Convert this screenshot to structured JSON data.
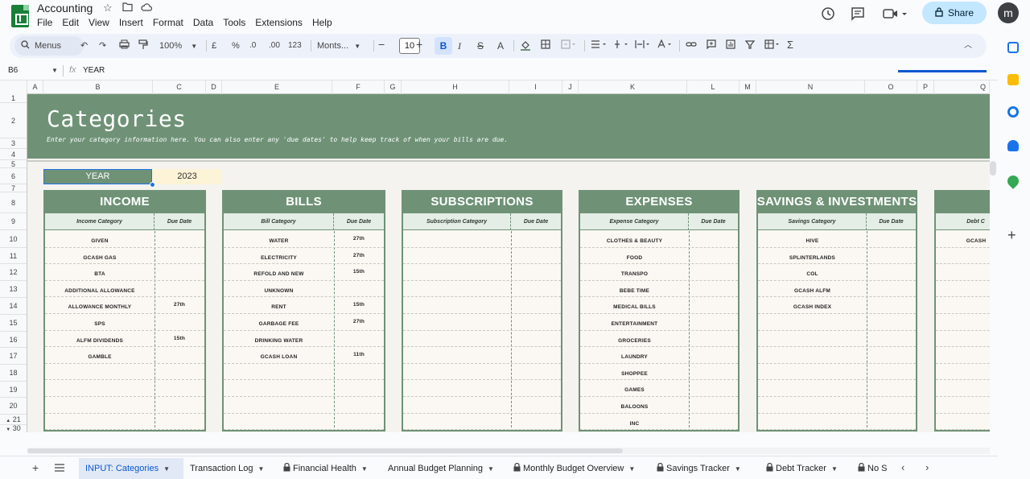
{
  "app": {
    "doc_title": "Accounting",
    "menu": [
      "File",
      "Edit",
      "View",
      "Insert",
      "Format",
      "Data",
      "Tools",
      "Extensions",
      "Help"
    ],
    "share_label": "Share",
    "avatar_letter": "m"
  },
  "toolbar": {
    "menus_label": "Menus",
    "zoom": "100%",
    "currency": "£",
    "percent": "%",
    "dec_decrease": ".0",
    "dec_increase": ".00",
    "number_format": "123",
    "font": "Monts...",
    "font_size": "10",
    "bold": "B",
    "italic": "I",
    "strike": "S",
    "text_color": "A",
    "sigma": "Σ"
  },
  "formula_bar": {
    "cell_ref": "B6",
    "content": "YEAR"
  },
  "columns": [
    "A",
    "B",
    "C",
    "D",
    "E",
    "F",
    "G",
    "H",
    "I",
    "J",
    "K",
    "L",
    "M",
    "N",
    "O",
    "P",
    "Q"
  ],
  "rows": [
    "1",
    "2",
    "3",
    "4",
    "5",
    "6",
    "7",
    "8",
    "9",
    "10",
    "11",
    "12",
    "13",
    "14",
    "15",
    "16",
    "17",
    "18",
    "19",
    "20",
    "21",
    "30"
  ],
  "sheet": {
    "title": "Categories",
    "subtitle": "Enter your category information here. You can also enter any 'due dates' to help keep track of when your bills are due.",
    "year_label": "YEAR",
    "year_value": "2023"
  },
  "cards": [
    {
      "title": "INCOME",
      "cat_header": "Income Category",
      "due_header": "Due Date",
      "items": [
        {
          "name": "GIVEN",
          "due": ""
        },
        {
          "name": "GCASH GAS",
          "due": ""
        },
        {
          "name": "BTA",
          "due": ""
        },
        {
          "name": "ADDITIONAL ALLOWANCE",
          "due": ""
        },
        {
          "name": "ALLOWANCE MONTHLY",
          "due": "27th"
        },
        {
          "name": "SPS",
          "due": ""
        },
        {
          "name": "ALFM DIVIDENDS",
          "due": "15th"
        },
        {
          "name": "GAMBLE",
          "due": ""
        }
      ]
    },
    {
      "title": "BILLS",
      "cat_header": "Bill Category",
      "due_header": "Due Date",
      "items": [
        {
          "name": "WATER",
          "due": "27th"
        },
        {
          "name": "ELECTRICITY",
          "due": "27th"
        },
        {
          "name": "REFOLD AND NEW",
          "due": "15th"
        },
        {
          "name": "UNKNOWN",
          "due": ""
        },
        {
          "name": "RENT",
          "due": "15th"
        },
        {
          "name": "GARBAGE FEE",
          "due": "27th"
        },
        {
          "name": "DRINKING WATER",
          "due": ""
        },
        {
          "name": "GCASH LOAN",
          "due": "11th"
        }
      ]
    },
    {
      "title": "SUBSCRIPTIONS",
      "cat_header": "Subscription Category",
      "due_header": "Due Date",
      "items": []
    },
    {
      "title": "EXPENSES",
      "cat_header": "Expense Category",
      "due_header": "Due Date",
      "items": [
        {
          "name": "CLOTHES & BEAUTY",
          "due": ""
        },
        {
          "name": "FOOD",
          "due": ""
        },
        {
          "name": "TRANSPO",
          "due": ""
        },
        {
          "name": "BEBE TIME",
          "due": ""
        },
        {
          "name": "MEDICAL BILLS",
          "due": ""
        },
        {
          "name": "ENTERTAINMENT",
          "due": ""
        },
        {
          "name": "GROCERIES",
          "due": ""
        },
        {
          "name": "LAUNDRY",
          "due": ""
        },
        {
          "name": "SHOPPEE",
          "due": ""
        },
        {
          "name": "GAMES",
          "due": ""
        },
        {
          "name": "BALOONS",
          "due": ""
        },
        {
          "name": "INC",
          "due": ""
        }
      ]
    },
    {
      "title": "SAVINGS & INVESTMENTS",
      "cat_header": "Savings Category",
      "due_header": "Due Date",
      "items": [
        {
          "name": "HIVE",
          "due": ""
        },
        {
          "name": "SPLINTERLANDS",
          "due": ""
        },
        {
          "name": "COL",
          "due": ""
        },
        {
          "name": "GCASH ALFM",
          "due": ""
        },
        {
          "name": "GCASH INDEX",
          "due": ""
        }
      ]
    },
    {
      "title": "",
      "cat_header": "Debt C",
      "due_header": "",
      "items": [
        {
          "name": "GCASH",
          "due": ""
        }
      ]
    }
  ],
  "tabs": [
    {
      "label": "INPUT: Categories",
      "locked": false,
      "active": true
    },
    {
      "label": "Transaction Log",
      "locked": false,
      "active": false
    },
    {
      "label": "Financial Health",
      "locked": true,
      "active": false
    },
    {
      "label": "Annual Budget Planning",
      "locked": false,
      "active": false
    },
    {
      "label": "Monthly Budget Overview",
      "locked": true,
      "active": false
    },
    {
      "label": "Savings Tracker",
      "locked": true,
      "active": false
    },
    {
      "label": "Debt Tracker",
      "locked": true,
      "active": false
    },
    {
      "label": "No S",
      "locked": true,
      "active": false
    }
  ],
  "colors": {
    "header_green": "#6f9277",
    "sub_green": "#e5eee6",
    "card_bg": "#fbf8f3",
    "year_bg": "#fdf3d6",
    "share_bg": "#c2e7ff"
  }
}
